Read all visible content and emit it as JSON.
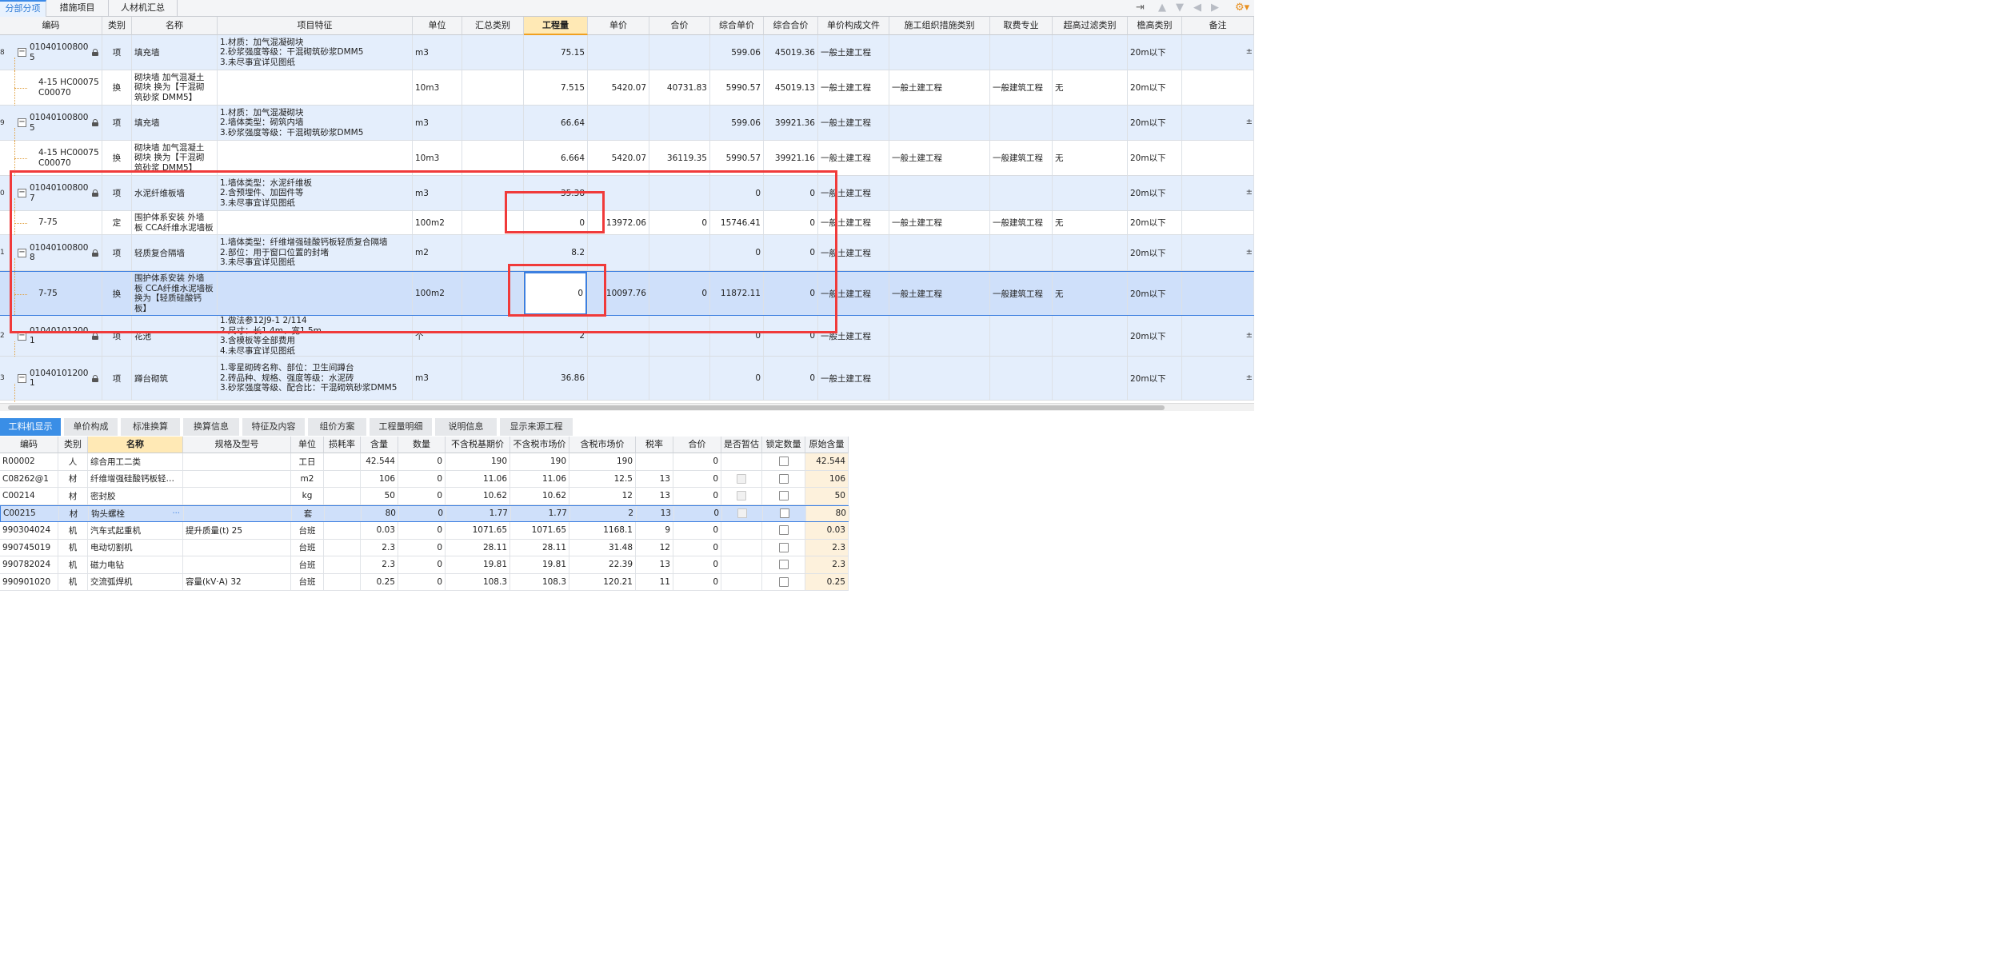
{
  "top_tabs": [
    "分部分项",
    "措施项目",
    "人材机汇总"
  ],
  "toolbar_icons": [
    "move-first-icon",
    "arrow-up-icon",
    "arrow-down-icon",
    "arrow-left-icon",
    "arrow-right-icon",
    "settings-icon"
  ],
  "main_table": {
    "headers": [
      "编码",
      "类别",
      "名称",
      "项目特征",
      "单位",
      "汇总类别",
      "工程量",
      "单价",
      "合价",
      "综合单价",
      "综合合价",
      "单价构成文件",
      "施工组织措施类别",
      "取费专业",
      "超高过滤类别",
      "檐高类别",
      "备注"
    ],
    "rows": [
      {
        "num": "8",
        "type": "item",
        "code": [
          "01040100800",
          "5"
        ],
        "cat": "项",
        "name": "填充墙",
        "features": [
          "1.材质：加气混凝砌块",
          "2.砂浆强度等级：干混砌筑砂浆DMM5",
          "3.未尽事宜详见图纸"
        ],
        "unit": "m3",
        "summary": "",
        "qty": "75.15",
        "price": "",
        "amount": "",
        "comp_price": "599.06",
        "comp_amount": "45019.36",
        "price_file": "一般土建工程",
        "measure_cat": "",
        "fee_major": "",
        "overheight": "",
        "eave": "20m以下",
        "remark": "",
        "extra": "±"
      },
      {
        "num": "",
        "type": "sub",
        "code": [
          "4-15 HC00075",
          "C00070"
        ],
        "cat": "换",
        "name": [
          "砌块墙 加气混凝土",
          "砌块  换为【干混砌",
          "筑砂浆 DMM5】"
        ],
        "features": [],
        "unit": "10m3",
        "summary": "",
        "qty": "7.515",
        "price": "5420.07",
        "amount": "40731.83",
        "comp_price": "5990.57",
        "comp_amount": "45019.13",
        "price_file": "一般土建工程",
        "measure_cat": "一般土建工程",
        "fee_major": "一般建筑工程",
        "overheight": "无",
        "eave": "20m以下",
        "remark": "",
        "extra": ""
      },
      {
        "num": "9",
        "type": "item",
        "code": [
          "01040100800",
          "5"
        ],
        "cat": "项",
        "name": "填充墙",
        "features": [
          "1.材质：加气混凝砌块",
          "2.墙体类型：砌筑内墙",
          "3.砂浆强度等级：干混砌筑砂浆DMM5"
        ],
        "unit": "m3",
        "summary": "",
        "qty": "66.64",
        "price": "",
        "amount": "",
        "comp_price": "599.06",
        "comp_amount": "39921.36",
        "price_file": "一般土建工程",
        "measure_cat": "",
        "fee_major": "",
        "overheight": "",
        "eave": "20m以下",
        "remark": "",
        "extra": "±"
      },
      {
        "num": "",
        "type": "sub",
        "code": [
          "4-15 HC00075",
          "C00070"
        ],
        "cat": "换",
        "name": [
          "砌块墙 加气混凝土",
          "砌块  换为【干混砌",
          "筑砂浆 DMM5】"
        ],
        "features": [],
        "unit": "10m3",
        "summary": "",
        "qty": "6.664",
        "price": "5420.07",
        "amount": "36119.35",
        "comp_price": "5990.57",
        "comp_amount": "39921.16",
        "price_file": "一般土建工程",
        "measure_cat": "一般土建工程",
        "fee_major": "一般建筑工程",
        "overheight": "无",
        "eave": "20m以下",
        "remark": "",
        "extra": ""
      },
      {
        "num": "0",
        "type": "item",
        "code": [
          "01040100800",
          "7"
        ],
        "cat": "项",
        "name": "水泥纤维板墙",
        "features": [
          "1.墙体类型：水泥纤维板",
          "2.含预埋件、加固件等",
          "3.未尽事宜详见图纸"
        ],
        "unit": "m3",
        "summary": "",
        "qty": "35.38",
        "price": "",
        "amount": "",
        "comp_price": "0",
        "comp_amount": "0",
        "price_file": "一般土建工程",
        "measure_cat": "",
        "fee_major": "",
        "overheight": "",
        "eave": "20m以下",
        "remark": "",
        "extra": "±"
      },
      {
        "num": "",
        "type": "sub",
        "code": [
          "7-75"
        ],
        "cat": "定",
        "name": [
          "围护体系安装 外墙",
          "板 CCA纤维水泥墙板"
        ],
        "features": [],
        "unit": "100m2",
        "summary": "",
        "qty": "0",
        "price": "13972.06",
        "amount": "0",
        "comp_price": "15746.41",
        "comp_amount": "0",
        "price_file": "一般土建工程",
        "measure_cat": "一般土建工程",
        "fee_major": "一般建筑工程",
        "overheight": "无",
        "eave": "20m以下",
        "remark": "",
        "extra": ""
      },
      {
        "num": "1",
        "type": "item",
        "code": [
          "01040100800",
          "8"
        ],
        "cat": "项",
        "name": "轻质复合隔墙",
        "features": [
          "1.墙体类型：纤维增强硅酸钙板轻质复合隔墙",
          "2.部位：用于窗口位置的封堵",
          "3.未尽事宜详见图纸"
        ],
        "unit": "m2",
        "summary": "",
        "qty": "8.2",
        "price": "",
        "amount": "",
        "comp_price": "0",
        "comp_amount": "0",
        "price_file": "一般土建工程",
        "measure_cat": "",
        "fee_major": "",
        "overheight": "",
        "eave": "20m以下",
        "remark": "",
        "extra": "±"
      },
      {
        "num": "",
        "type": "sel",
        "code": [
          "7-75"
        ],
        "cat": "换",
        "name": [
          "围护体系安装 外墙",
          "板 CCA纤维水泥墙板",
          "  换为【轻质硅酸钙",
          "板】"
        ],
        "features": [],
        "unit": "100m2",
        "summary": "",
        "qty": "0",
        "price": "10097.76",
        "amount": "0",
        "comp_price": "11872.11",
        "comp_amount": "0",
        "price_file": "一般土建工程",
        "measure_cat": "一般土建工程",
        "fee_major": "一般建筑工程",
        "overheight": "无",
        "eave": "20m以下",
        "remark": "",
        "extra": ""
      },
      {
        "num": "2",
        "type": "item",
        "code": [
          "01040101200",
          "1"
        ],
        "cat": "项",
        "name": "花池",
        "features": [
          "1.做法参12J9-1 2/114",
          "2.尺寸：长1.4m、宽1.5m",
          "3.含模板等全部费用",
          "4.未尽事宜详见图纸"
        ],
        "unit": "个",
        "summary": "",
        "qty": "2",
        "price": "",
        "amount": "",
        "comp_price": "0",
        "comp_amount": "0",
        "price_file": "一般土建工程",
        "measure_cat": "",
        "fee_major": "",
        "overheight": "",
        "eave": "20m以下",
        "remark": "",
        "extra": "±"
      },
      {
        "num": "3",
        "type": "item",
        "code": [
          "01040101200",
          "1"
        ],
        "cat": "项",
        "name": "蹲台砌筑",
        "features": [
          "1.零星砌砖名称、部位：卫生间蹲台",
          "2.砖品种、规格、强度等级：水泥砖",
          "3.砂浆强度等级、配合比：干混砌筑砂浆DMM5"
        ],
        "unit": "m3",
        "summary": "",
        "qty": "36.86",
        "price": "",
        "amount": "",
        "comp_price": "0",
        "comp_amount": "0",
        "price_file": "一般土建工程",
        "measure_cat": "",
        "fee_major": "",
        "overheight": "",
        "eave": "20m以下",
        "remark": "",
        "extra": "±"
      }
    ]
  },
  "bottom_tabs": [
    "工料机显示",
    "单价构成",
    "标准换算",
    "换算信息",
    "特征及内容",
    "组价方案",
    "工程量明细",
    "说明信息",
    "显示来源工程"
  ],
  "resource_table": {
    "headers": [
      "编码",
      "类别",
      "名称",
      "规格及型号",
      "单位",
      "损耗率",
      "含量",
      "数量",
      "不含税基期价",
      "不含税市场价",
      "含税市场价",
      "税率",
      "合价",
      "是否暂估",
      "锁定数量",
      "原始含量"
    ],
    "rows": [
      {
        "code": "R00002",
        "cat": "人",
        "name": "综合用工二类",
        "spec": "",
        "unit": "工日",
        "loss": "",
        "content": "42.544",
        "qty": "0",
        "base": "190",
        "market": "190",
        "tax_market": "190",
        "rate": "",
        "amount": "0",
        "est": "none",
        "lock": true,
        "orig": "42.544"
      },
      {
        "code": "C08262@1",
        "cat": "材",
        "name": "纤维增强硅酸钙板轻…",
        "spec": "",
        "unit": "m2",
        "loss": "",
        "content": "106",
        "qty": "0",
        "base": "11.06",
        "market": "11.06",
        "tax_market": "12.5",
        "rate": "13",
        "amount": "0",
        "est": "dis",
        "lock": true,
        "orig": "106"
      },
      {
        "code": "C00214",
        "cat": "材",
        "name": "密封胶",
        "spec": "",
        "unit": "kg",
        "loss": "",
        "content": "50",
        "qty": "0",
        "base": "10.62",
        "market": "10.62",
        "tax_market": "12",
        "rate": "13",
        "amount": "0",
        "est": "dis",
        "lock": true,
        "orig": "50"
      },
      {
        "code": "C00215",
        "cat": "材",
        "name": "钩头螺栓",
        "spec": "",
        "unit": "套",
        "loss": "",
        "content": "80",
        "qty": "0",
        "base": "1.77",
        "market": "1.77",
        "tax_market": "2",
        "rate": "13",
        "amount": "0",
        "est": "dis",
        "lock": true,
        "orig": "80",
        "selected": true
      },
      {
        "code": "990304024",
        "cat": "机",
        "name": "汽车式起重机",
        "spec": "提升质量(t) 25",
        "unit": "台班",
        "loss": "",
        "content": "0.03",
        "qty": "0",
        "base": "1071.65",
        "market": "1071.65",
        "tax_market": "1168.1",
        "rate": "9",
        "amount": "0",
        "est": "none",
        "lock": true,
        "orig": "0.03"
      },
      {
        "code": "990745019",
        "cat": "机",
        "name": "电动切割机",
        "spec": "",
        "unit": "台班",
        "loss": "",
        "content": "2.3",
        "qty": "0",
        "base": "28.11",
        "market": "28.11",
        "tax_market": "31.48",
        "rate": "12",
        "amount": "0",
        "est": "none",
        "lock": true,
        "orig": "2.3"
      },
      {
        "code": "990782024",
        "cat": "机",
        "name": "磁力电钻",
        "spec": "",
        "unit": "台班",
        "loss": "",
        "content": "2.3",
        "qty": "0",
        "base": "19.81",
        "market": "19.81",
        "tax_market": "22.39",
        "rate": "13",
        "amount": "0",
        "est": "none",
        "lock": true,
        "orig": "2.3"
      },
      {
        "code": "990901020",
        "cat": "机",
        "name": "交流弧焊机",
        "spec": "容量(kV·A) 32",
        "unit": "台班",
        "loss": "",
        "content": "0.25",
        "qty": "0",
        "base": "108.3",
        "market": "108.3",
        "tax_market": "120.21",
        "rate": "11",
        "amount": "0",
        "est": "none",
        "lock": true,
        "orig": "0.25"
      }
    ]
  },
  "colors": {
    "accent": "#3a8ee6",
    "highlight_box": "#f03a3a",
    "row_blue": "#e4eefc",
    "row_selected": "#cfe0fa",
    "header_highlight": "#ffe9b5"
  }
}
